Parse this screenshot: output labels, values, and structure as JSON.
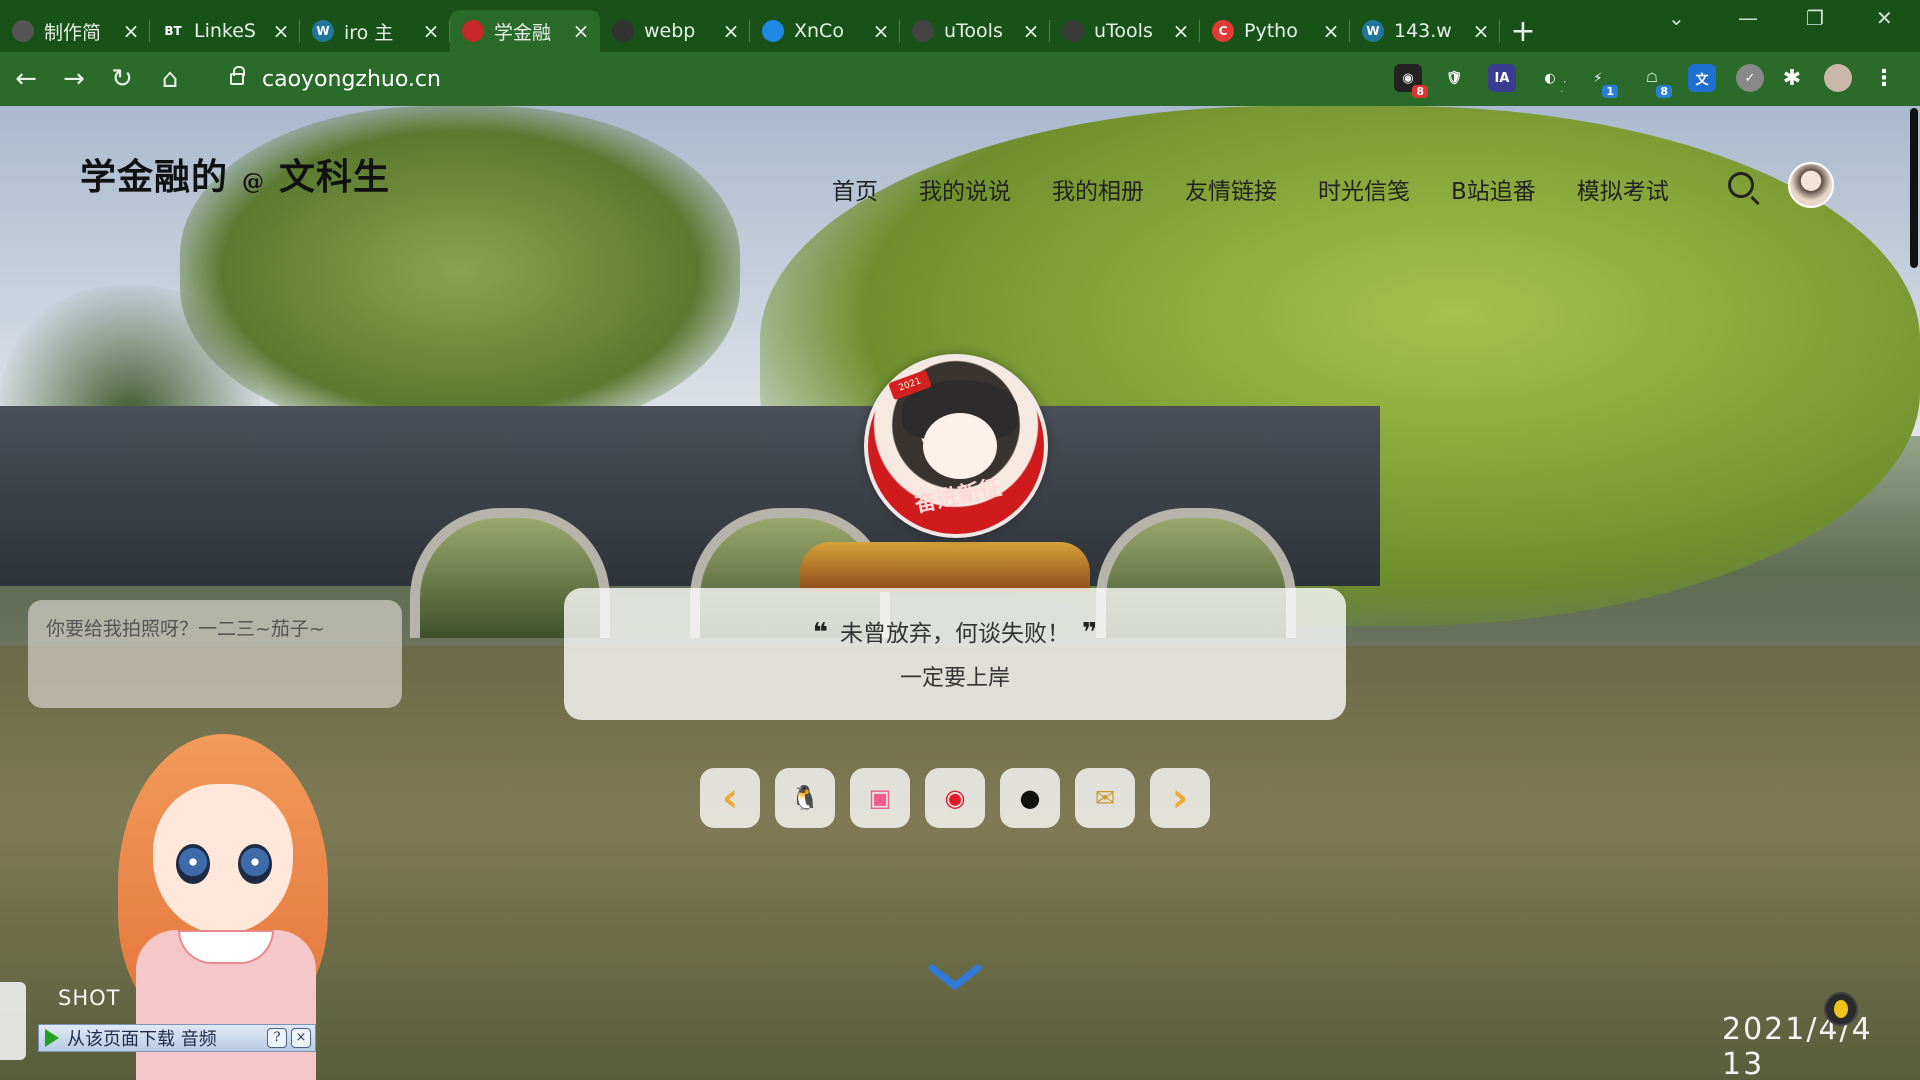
{
  "browser": {
    "tabs": [
      {
        "title": "制作简",
        "icon": "globe-icon",
        "color": "#555555"
      },
      {
        "title": "LinkeS",
        "icon": "bt-icon",
        "color": "#185218",
        "glyph": "BT"
      },
      {
        "title": "iro 主",
        "icon": "wordpress-icon",
        "color": "#21759b",
        "glyph": "W"
      },
      {
        "title": "学金融",
        "icon": "site-avatar-icon",
        "color": "#c62828",
        "active": true
      },
      {
        "title": "webp",
        "icon": "webp-icon",
        "color": "#333333"
      },
      {
        "title": "XnCo",
        "icon": "xnconvert-icon",
        "color": "#1e88e5"
      },
      {
        "title": "uTools",
        "icon": "utools-icon",
        "color": "#444444"
      },
      {
        "title": "uTools",
        "icon": "utools-icon",
        "color": "#3a3a3a"
      },
      {
        "title": "Pytho",
        "icon": "c-icon",
        "color": "#e53935",
        "glyph": "C"
      },
      {
        "title": "143.w",
        "icon": "wordpress-icon",
        "color": "#21759b",
        "glyph": "W"
      }
    ],
    "url": "caoyongzhuo.cn",
    "extension_badges": {
      "first": "8",
      "fifth": "1",
      "sixth": "8"
    },
    "extension_glyphs": {
      "ia": "IA"
    }
  },
  "site": {
    "logo_left": "学金融的",
    "logo_at": "@",
    "logo_right": "文科生",
    "nav": [
      "首页",
      "我的说说",
      "我的相册",
      "友情链接",
      "时光信笺",
      "B站追番",
      "模拟考试"
    ],
    "avatar_banner": "奋进新征",
    "avatar_badge": "2021",
    "quote": "未曾放弃，何谈失败！",
    "quote_open": "❝",
    "quote_close": "❞",
    "quote_sub": "一定要上岸",
    "social": [
      {
        "name": "prev",
        "glyph": "‹",
        "color": "#f0a830"
      },
      {
        "name": "qq",
        "glyph": "🐧",
        "color": "#222222"
      },
      {
        "name": "bilibili",
        "glyph": "▣",
        "color": "#f25d8e"
      },
      {
        "name": "weibo",
        "glyph": "◉",
        "color": "#e6162d"
      },
      {
        "name": "github",
        "glyph": "●",
        "color": "#111111"
      },
      {
        "name": "email",
        "glyph": "✉",
        "color": "#c79a2c"
      },
      {
        "name": "next",
        "glyph": "›",
        "color": "#f0a830"
      }
    ],
    "tip": "你要给我拍照呀？一二三~茄子~",
    "player_label": "从该页面下载 音频",
    "player_help": "?",
    "player_close": "×",
    "shot_text": "SHOT",
    "clock": "2021/4/4 13"
  }
}
